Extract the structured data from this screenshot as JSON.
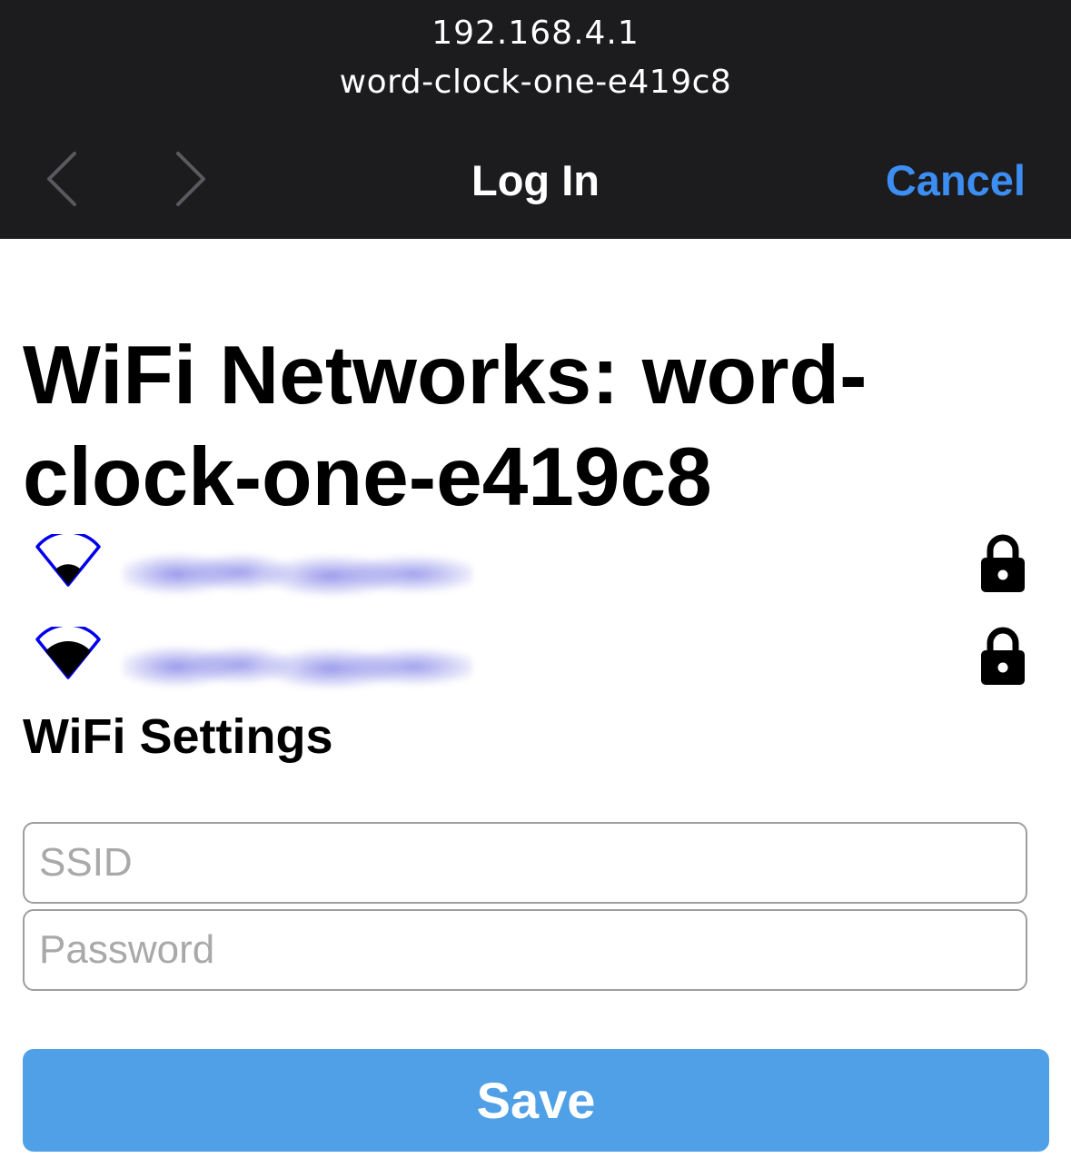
{
  "browser": {
    "url": "192.168.4.1",
    "host": "word-clock-one-e419c8",
    "title": "Log In",
    "cancel_label": "Cancel",
    "back_icon": "chevron-left-icon",
    "forward_icon": "chevron-right-icon"
  },
  "page": {
    "heading": "WiFi Networks: word-clock-one-e419c8",
    "networks": [
      {
        "signal": "weak",
        "secured": true
      },
      {
        "signal": "medium",
        "secured": true
      }
    ],
    "settings_heading": "WiFi Settings",
    "ssid_placeholder": "SSID",
    "password_placeholder": "Password",
    "save_label": "Save"
  },
  "colors": {
    "topbar": "#1c1c1e",
    "accent": "#3d8ef3",
    "button": "#4fa0e6",
    "wifi_stroke": "#0000ff"
  }
}
